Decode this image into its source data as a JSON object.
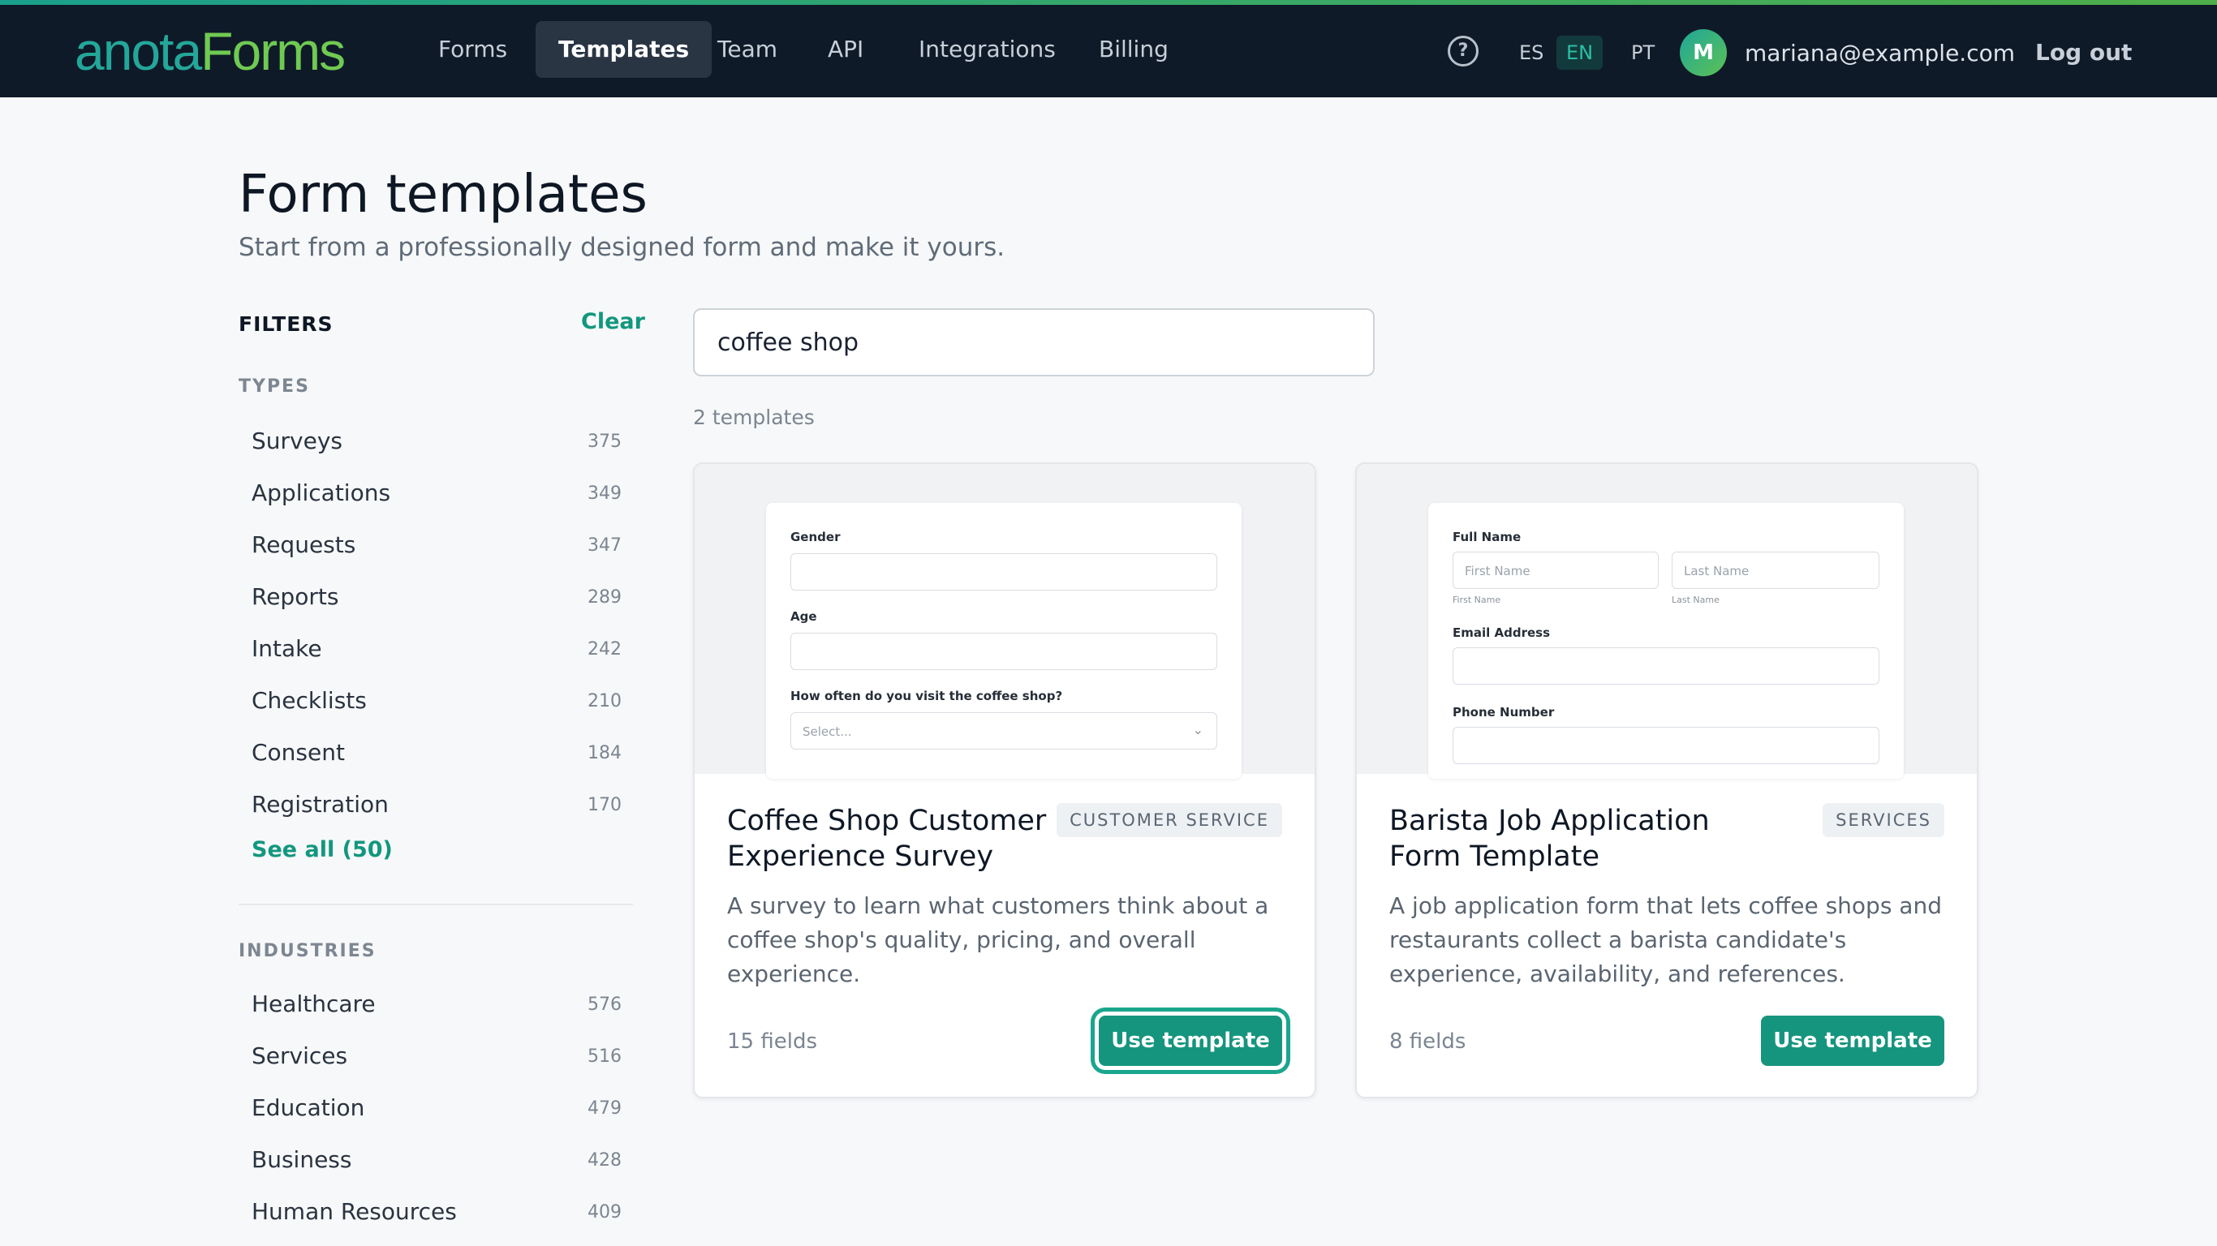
{
  "brand": {
    "part1": "anota",
    "part2": "Forms"
  },
  "nav": {
    "items": [
      {
        "label": "Forms",
        "active": false
      },
      {
        "label": "Templates",
        "active": true
      },
      {
        "label": "Team",
        "active": false
      },
      {
        "label": "API",
        "active": false
      },
      {
        "label": "Integrations",
        "active": false
      },
      {
        "label": "Billing",
        "active": false
      }
    ],
    "help_icon": "question-circle-icon",
    "languages": [
      {
        "code": "ES",
        "active": false
      },
      {
        "code": "EN",
        "active": true
      },
      {
        "code": "PT",
        "active": false
      }
    ],
    "user": {
      "initial": "M",
      "email": "mariana@example.com"
    },
    "logout_label": "Log out"
  },
  "header": {
    "title": "Form templates",
    "subtitle": "Start from a professionally designed form and make it yours."
  },
  "filters": {
    "title": "FILTERS",
    "clear_label": "Clear",
    "types": {
      "label": "TYPES",
      "items": [
        {
          "label": "Surveys",
          "count": "375"
        },
        {
          "label": "Applications",
          "count": "349"
        },
        {
          "label": "Requests",
          "count": "347"
        },
        {
          "label": "Reports",
          "count": "289"
        },
        {
          "label": "Intake",
          "count": "242"
        },
        {
          "label": "Checklists",
          "count": "210"
        },
        {
          "label": "Consent",
          "count": "184"
        },
        {
          "label": "Registration",
          "count": "170"
        }
      ],
      "see_all_label": "See all (50)"
    },
    "industries": {
      "label": "INDUSTRIES",
      "items": [
        {
          "label": "Healthcare",
          "count": "576"
        },
        {
          "label": "Services",
          "count": "516"
        },
        {
          "label": "Education",
          "count": "479"
        },
        {
          "label": "Business",
          "count": "428"
        },
        {
          "label": "Human Resources",
          "count": "409"
        }
      ]
    }
  },
  "search": {
    "value": "coffee shop"
  },
  "results": {
    "count_label": "2 templates",
    "cards": [
      {
        "title": "Coffee Shop Customer Experience Survey",
        "badge": "CUSTOMER SERVICE",
        "description": "A survey to learn what customers think about a coffee shop's quality, pricing, and overall experience.",
        "fields_label": "15 fields",
        "button_label": "Use template",
        "preview": {
          "gender_label": "Gender",
          "age_label": "Age",
          "visit_label": "How often do you visit the coffee shop?",
          "select_placeholder": "Select..."
        }
      },
      {
        "title": "Barista Job Application Form Template",
        "badge": "SERVICES",
        "description": "A job application form that lets coffee shops and restaurants collect a barista candidate's experience, availability, and references.",
        "fields_label": "8 fields",
        "button_label": "Use template",
        "preview": {
          "full_name_label": "Full Name",
          "first_name_placeholder": "First Name",
          "last_name_placeholder": "Last Name",
          "first_name_sub": "First Name",
          "last_name_sub": "Last Name",
          "email_label": "Email Address",
          "phone_label": "Phone Number"
        }
      }
    ]
  },
  "colors": {
    "brand_teal": "#23a79a",
    "brand_green": "#6fca52",
    "primary_button": "#16957e",
    "topbar": "#0f1a28"
  }
}
